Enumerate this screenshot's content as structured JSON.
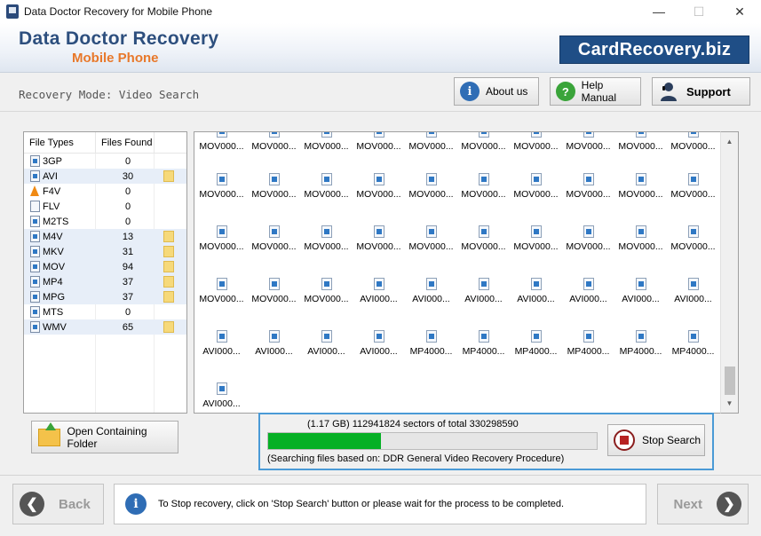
{
  "window": {
    "title": "Data Doctor Recovery for Mobile Phone",
    "minimize": "—",
    "maximize": "☐",
    "close": "✕"
  },
  "banner": {
    "brand_line1": "Data Doctor Recovery",
    "brand_line2": "Mobile Phone",
    "site": "CardRecovery.biz"
  },
  "mode": {
    "label": "Recovery Mode: Video Search"
  },
  "toolbar": {
    "about_label": "About us",
    "about_icon": "i",
    "help_label": "Help Manual",
    "help_icon": "?",
    "support_label": "Support"
  },
  "file_types": {
    "header_type": "File Types",
    "header_found": "Files Found",
    "rows": [
      {
        "type": "3GP",
        "found": "0"
      },
      {
        "type": "AVI",
        "found": "30"
      },
      {
        "type": "F4V",
        "found": "0"
      },
      {
        "type": "FLV",
        "found": "0"
      },
      {
        "type": "M2TS",
        "found": "0"
      },
      {
        "type": "M4V",
        "found": "13"
      },
      {
        "type": "MKV",
        "found": "31"
      },
      {
        "type": "MOV",
        "found": "94"
      },
      {
        "type": "MP4",
        "found": "37"
      },
      {
        "type": "MPG",
        "found": "37"
      },
      {
        "type": "MTS",
        "found": "0"
      },
      {
        "type": "WMV",
        "found": "65"
      }
    ]
  },
  "results": {
    "rows": [
      [
        "MOV000...",
        "MOV000...",
        "MOV000...",
        "MOV000...",
        "MOV000...",
        "MOV000...",
        "MOV000...",
        "MOV000...",
        "MOV000...",
        "MOV000..."
      ],
      [
        "MOV000...",
        "MOV000...",
        "MOV000...",
        "MOV000...",
        "MOV000...",
        "MOV000...",
        "MOV000...",
        "MOV000...",
        "MOV000...",
        "MOV000..."
      ],
      [
        "MOV000...",
        "MOV000...",
        "MOV000...",
        "MOV000...",
        "MOV000...",
        "MOV000...",
        "MOV000...",
        "MOV000...",
        "MOV000...",
        "MOV000..."
      ],
      [
        "MOV000...",
        "MOV000...",
        "MOV000...",
        "AVI000...",
        "AVI000...",
        "AVI000...",
        "AVI000...",
        "AVI000...",
        "AVI000...",
        "AVI000..."
      ],
      [
        "AVI000...",
        "AVI000...",
        "AVI000...",
        "AVI000...",
        "MP4000...",
        "MP4000...",
        "MP4000...",
        "MP4000...",
        "MP4000...",
        "MP4000..."
      ],
      [
        "AVI000..."
      ]
    ]
  },
  "open_folder": {
    "label": "Open Containing Folder"
  },
  "progress": {
    "status": "(1.17 GB) 112941824  sectors  of  total 330298590",
    "fraction": 0.342,
    "basis": "(Searching files based on:  DDR General Video Recovery Procedure)",
    "stop_label": "Stop Search"
  },
  "footer": {
    "back_label": "Back",
    "back_icon": "❮",
    "next_label": "Next",
    "next_icon": "❯",
    "info_icon": "i",
    "info_text": "To Stop recovery, click on 'Stop Search' button or please wait for the process to be completed."
  }
}
